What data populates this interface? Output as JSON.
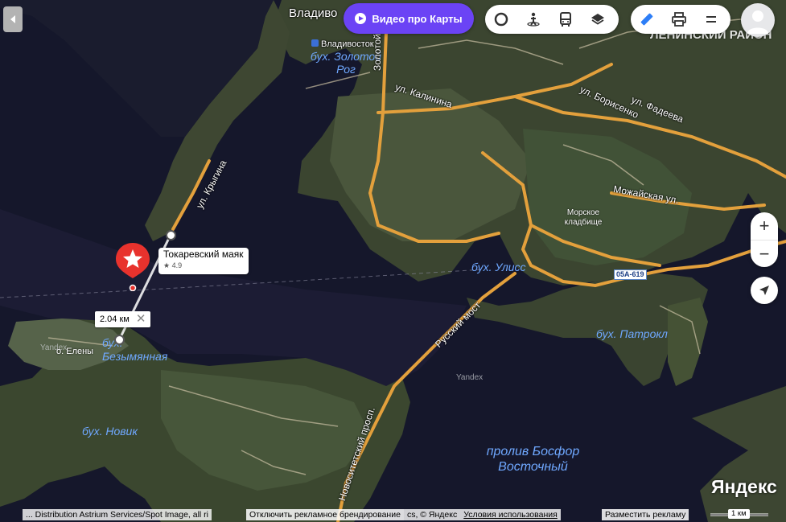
{
  "top_bar": {
    "video_button_label": "Видео про Карты",
    "tools_left": [
      {
        "icon": "layers-circle-icon"
      },
      {
        "icon": "panorama-person-icon"
      },
      {
        "icon": "bus-transit-icon"
      },
      {
        "icon": "map-layers-icon"
      }
    ],
    "tools_right": [
      {
        "icon": "ruler-icon"
      },
      {
        "icon": "printer-icon"
      },
      {
        "icon": "menu-icon"
      }
    ],
    "avatar_icon": "user-avatar-icon"
  },
  "map": {
    "city_label": "Владиво",
    "district_label": "ЛЕНИНСКИЙ РАЙОН",
    "station_label": "Владивосток",
    "water_labels": {
      "zolotoy_rog": "бух. Золотой Рог",
      "uliss": "бух. Улисс",
      "patrokl": "бух. Патрокл",
      "bezymyannaya": "бух. Безымянная",
      "novik": "бух. Новик",
      "bosfor": "пролив Босфор Восточный"
    },
    "road_labels": {
      "zolotoy_most": "Золотой мост",
      "kalinina": "ул. Калинина",
      "borisenko": "ул. Борисенко",
      "fadeeva": "ул. Фадеева",
      "mozhayskaya": "Можайская ул.",
      "krygina": "ул. Крыгина",
      "russkiy_most": "Русский мост",
      "novositetsky": "Новоситетский просп."
    },
    "area_labels": {
      "cemetery": "Морское кладбище",
      "elena_island": "о. Елены"
    },
    "watermarks": [
      "Yandex",
      "Yandex"
    ],
    "route_shield": "05А-619"
  },
  "place": {
    "name": "Токаревский маяк",
    "rating": "4.9",
    "marker_icon": "star-pin-icon"
  },
  "ruler": {
    "distance": "2.04 км"
  },
  "controls": {
    "zoom_in": "+",
    "zoom_out": "−"
  },
  "footer": {
    "attribution": "... Distribution Astrium Services/Spot Image, all ri",
    "disable_branding": "Отключить рекламное брендирование",
    "copyright": "cs, © Яндекс",
    "terms": "Условия использования",
    "advertise": "Разместить рекламу",
    "logo": "Яндекс",
    "scale": "1 км"
  },
  "colors": {
    "water": "#14162a",
    "land": "#3e4a34",
    "road": "#e3a03c",
    "accent": "#6b43f5",
    "pin": "#e8322d"
  }
}
